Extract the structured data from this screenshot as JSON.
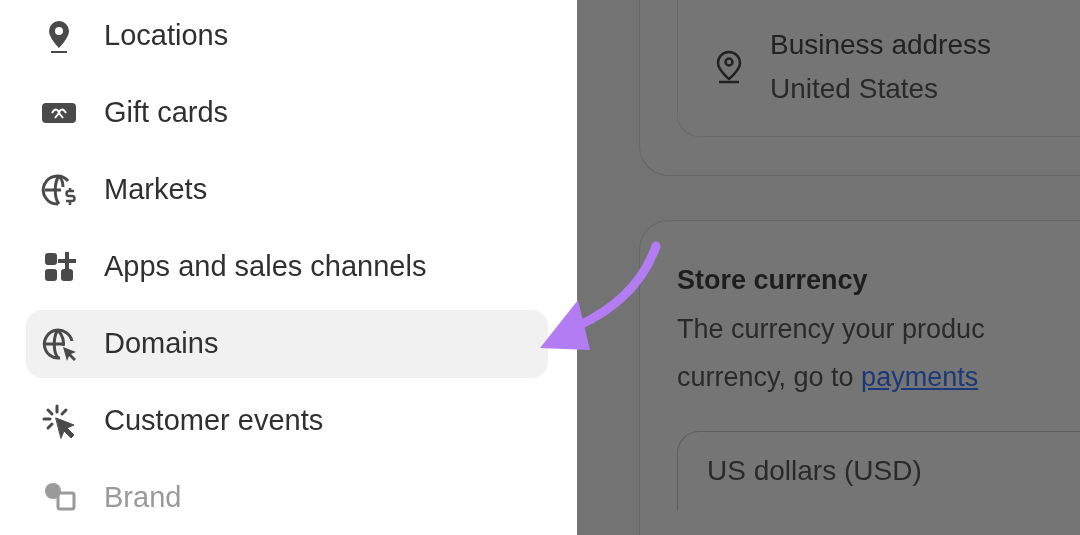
{
  "sidebar": {
    "items": [
      {
        "label": "Locations",
        "selected": false
      },
      {
        "label": "Gift cards",
        "selected": false
      },
      {
        "label": "Markets",
        "selected": false
      },
      {
        "label": "Apps and sales channels",
        "selected": false
      },
      {
        "label": "Domains",
        "selected": true
      },
      {
        "label": "Customer events",
        "selected": false
      },
      {
        "label": "Brand",
        "selected": false
      }
    ]
  },
  "business_address": {
    "title": "Business address",
    "country": "United States"
  },
  "store_currency": {
    "title": "Store currency",
    "description_line_1": "The currency your produc",
    "description_line_2": "currency, go to",
    "link": "payments",
    "select_value": "US dollars (USD)"
  }
}
